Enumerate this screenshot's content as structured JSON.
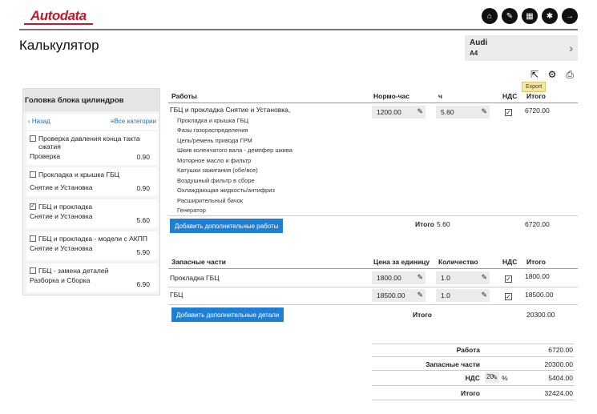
{
  "brand": {
    "logo_text": "Autodata",
    "color": "#c0192b"
  },
  "header": {
    "icons": [
      "home-icon",
      "wrench-icon",
      "calculator-icon",
      "gear-icon",
      "logout-icon"
    ],
    "title": "Калькулятор"
  },
  "vehicle": {
    "make": "Audi",
    "model": "A4"
  },
  "toolbar": {
    "tooltip": "Export"
  },
  "sidebar": {
    "title": "Головка блока цилиндров",
    "back_label": "Назад",
    "all_label": "Все категории",
    "items": [
      {
        "name": "Проверка давления конца такта сжатия",
        "operation": "Проверка",
        "hours": "0.90",
        "checked": false
      },
      {
        "name": "Прокладка и крышка ГБЦ",
        "operation": "Снятие и Установка",
        "hours": "0.90",
        "checked": false
      },
      {
        "name": "ГБЦ и прокладка",
        "operation": "Снятие и Установка",
        "hours": "5.60",
        "checked": true
      },
      {
        "name": "ГБЦ и прокладка - модели с АКПП",
        "operation": "Снятие и Установка",
        "hours": "5.90",
        "checked": false
      },
      {
        "name": "ГБЦ - замена деталей",
        "operation": "Разборка и Сборка",
        "hours": "6.90",
        "checked": false
      }
    ]
  },
  "labour": {
    "headers": {
      "work": "Работы",
      "rate": "Нормо-час",
      "hours": "ч",
      "vat": "НДС",
      "total": "Итого"
    },
    "job_title": "ГБЦ и прокладка Снятие и Установка,",
    "includes": [
      "Прокладка и крышка ГБЦ",
      "Фазы газораспределения",
      "Цепь/ремень привода ГРМ",
      "Шкив коленчатого вала - демпфер шкива",
      "Моторное масло и фильтр",
      "Катушки зажигания (обе/все)",
      "Воздушный фильтр в сборе",
      "Охлаждающая жидкость/антифриз",
      "Расширительный бачок",
      "Генератор"
    ],
    "rate": "1200.00",
    "hours": "5.60",
    "line_total": "6720.00",
    "add_button": "Добавить дополнительные работы",
    "total_label": "Итого",
    "total_hours": "5.60",
    "total": "6720.00"
  },
  "parts": {
    "headers": {
      "part": "Запасные части",
      "price": "Цена за единицу",
      "qty": "Количество",
      "vat": "НДС",
      "total": "Итого"
    },
    "rows": [
      {
        "name": "Прокладка ГБЦ",
        "price": "1800.00",
        "qty": "1.0",
        "total": "1800.00"
      },
      {
        "name": "ГБЦ",
        "price": "18500.00",
        "qty": "1.0",
        "total": "18500.00"
      }
    ],
    "add_button": "Добавить дополнительные детали",
    "total_label": "Итого",
    "total": "20300.00"
  },
  "summary": {
    "labour_label": "Работа",
    "labour": "6720.00",
    "parts_label": "Запасные части",
    "parts": "20300.00",
    "vat_label": "НДС",
    "vat_rate": "20",
    "vat_unit": "%",
    "vat": "5404.00",
    "total_label": "Итого",
    "total": "32424.00"
  }
}
